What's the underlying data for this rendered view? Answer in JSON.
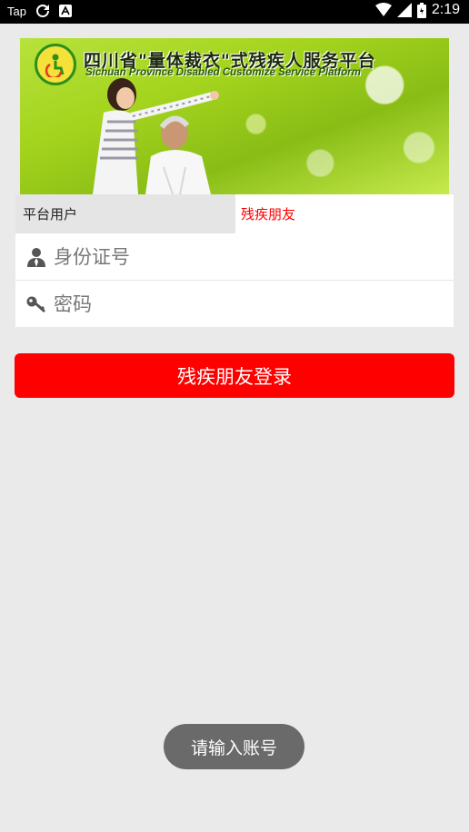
{
  "status_bar": {
    "carrier": "Tap",
    "time": "2:19"
  },
  "banner": {
    "title_cn": "四川省\"量体裁衣\"式残疾人服务平台",
    "title_en": "Sichuan Province Disabled Customize Service Platform"
  },
  "tabs": [
    {
      "label": "平台用户",
      "active": false
    },
    {
      "label": "残疾朋友",
      "active": true
    }
  ],
  "form": {
    "id_placeholder": "身份证号",
    "id_value": "",
    "password_placeholder": "密码",
    "password_value": ""
  },
  "login_button": "残疾朋友登录",
  "toast": "请输入账号",
  "colors": {
    "accent": "#ff0000",
    "background": "#eaeaea",
    "toast_bg": "#6a6a6a"
  }
}
